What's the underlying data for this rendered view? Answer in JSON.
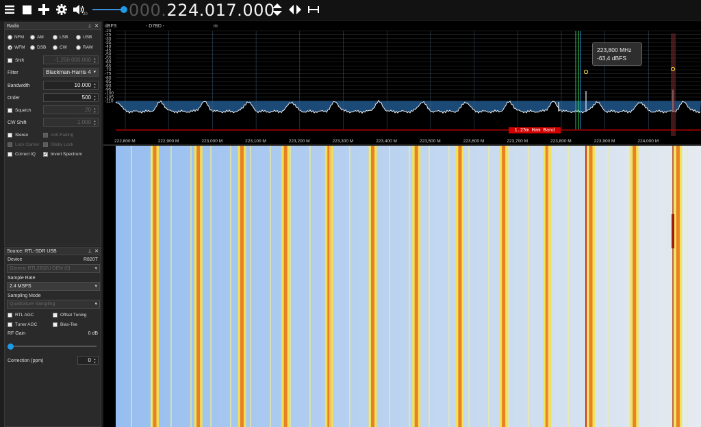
{
  "toolbar": {
    "menu_icon": "hamburger-menu-icon",
    "play_icon": "stop-square-icon",
    "add_icon": "plus-icon",
    "settings_icon": "gear-icon",
    "volume_icon": "speaker-icon",
    "volume_level": "20",
    "frequency_dim": "000.",
    "frequency_main": "224.017.000",
    "tuning_arrows_icon": "up-down-arrows-icon",
    "center_icon": "left-right-arrows-icon",
    "snap_icon": "snap-interval-icon"
  },
  "radio_panel": {
    "title": "Radio",
    "modes": [
      {
        "label": "NFM",
        "selected": false
      },
      {
        "label": "AM",
        "selected": false
      },
      {
        "label": "LSB",
        "selected": false
      },
      {
        "label": "USB",
        "selected": false
      },
      {
        "label": "WFM",
        "selected": true
      },
      {
        "label": "DSB",
        "selected": false
      },
      {
        "label": "CW",
        "selected": false
      },
      {
        "label": "RAW",
        "selected": false
      }
    ],
    "shift_label": "Shift",
    "shift_value": "-1.250.000.000",
    "filter_label": "Filter",
    "filter_value": "Blackman-Harris 4",
    "bandwidth_label": "Bandwidth",
    "bandwidth_value": "10.000",
    "order_label": "Order",
    "order_value": "500",
    "squelch_label": "Squelch",
    "squelch_value": "20",
    "cw_shift_label": "CW Shift",
    "cw_shift_value": "1.000",
    "stereo_label": "Stereo",
    "anti_fading_label": "Anti-Fading",
    "lock_carrier_label": "Lock Carrier",
    "sticky_lock_label": "Sticky Lock",
    "correct_iq_label": "Correct IQ",
    "invert_spectrum_label": "Invert Spectrum"
  },
  "source_panel": {
    "title": "Source: RTL-SDR USB",
    "device_label": "Device",
    "device_value": "R820T",
    "device_selected": "Generic RTL2832U OEM (0)",
    "sample_rate_label": "Sample Rate",
    "sample_rate_value": "2.4 MSPS",
    "sampling_mode_label": "Sampling Mode",
    "sampling_mode_value": "Quadrature Sampling",
    "rtl_agc_label": "RTL AGC",
    "offset_tuning_label": "Offset Tuning",
    "tuner_agc_label": "Tuner AGC",
    "bias_tee_label": "Bias-Tee",
    "rf_gain_label": "RF Gain",
    "rf_gain_value": "0 dB",
    "rf_gain_level": 0,
    "correction_label": "Correction (ppm)",
    "correction_value": "0"
  },
  "spectrum": {
    "unit_label": "dBFS",
    "top_text_1": "- D7BD -",
    "top_text_2": "m",
    "y_ticks": [
      "-20",
      "-25",
      "-30",
      "-35",
      "-40",
      "-45",
      "-50",
      "-55",
      "-60",
      "-65",
      "-70",
      "-75",
      "-80",
      "-85",
      "-90",
      "-95",
      "-100",
      "-105",
      "-110"
    ],
    "x_ticks": [
      "222,800 M",
      "222,900 M",
      "223,000 M",
      "223,100 M",
      "223,200 M",
      "223,300 M",
      "223,400 M",
      "223,500 M",
      "223,600 M",
      "223,700 M",
      "223,800 M",
      "223,900 M",
      "224,000 M"
    ],
    "tooltip_freq": "223,800 MHz",
    "tooltip_level": "-63,4 dBFS",
    "band_label": "1.25m Ham Band",
    "colors": {
      "fill": "#1d4e7c",
      "trace": "#e8eef5",
      "band": "#d00000",
      "vfo": "#7a2a2a"
    }
  }
}
